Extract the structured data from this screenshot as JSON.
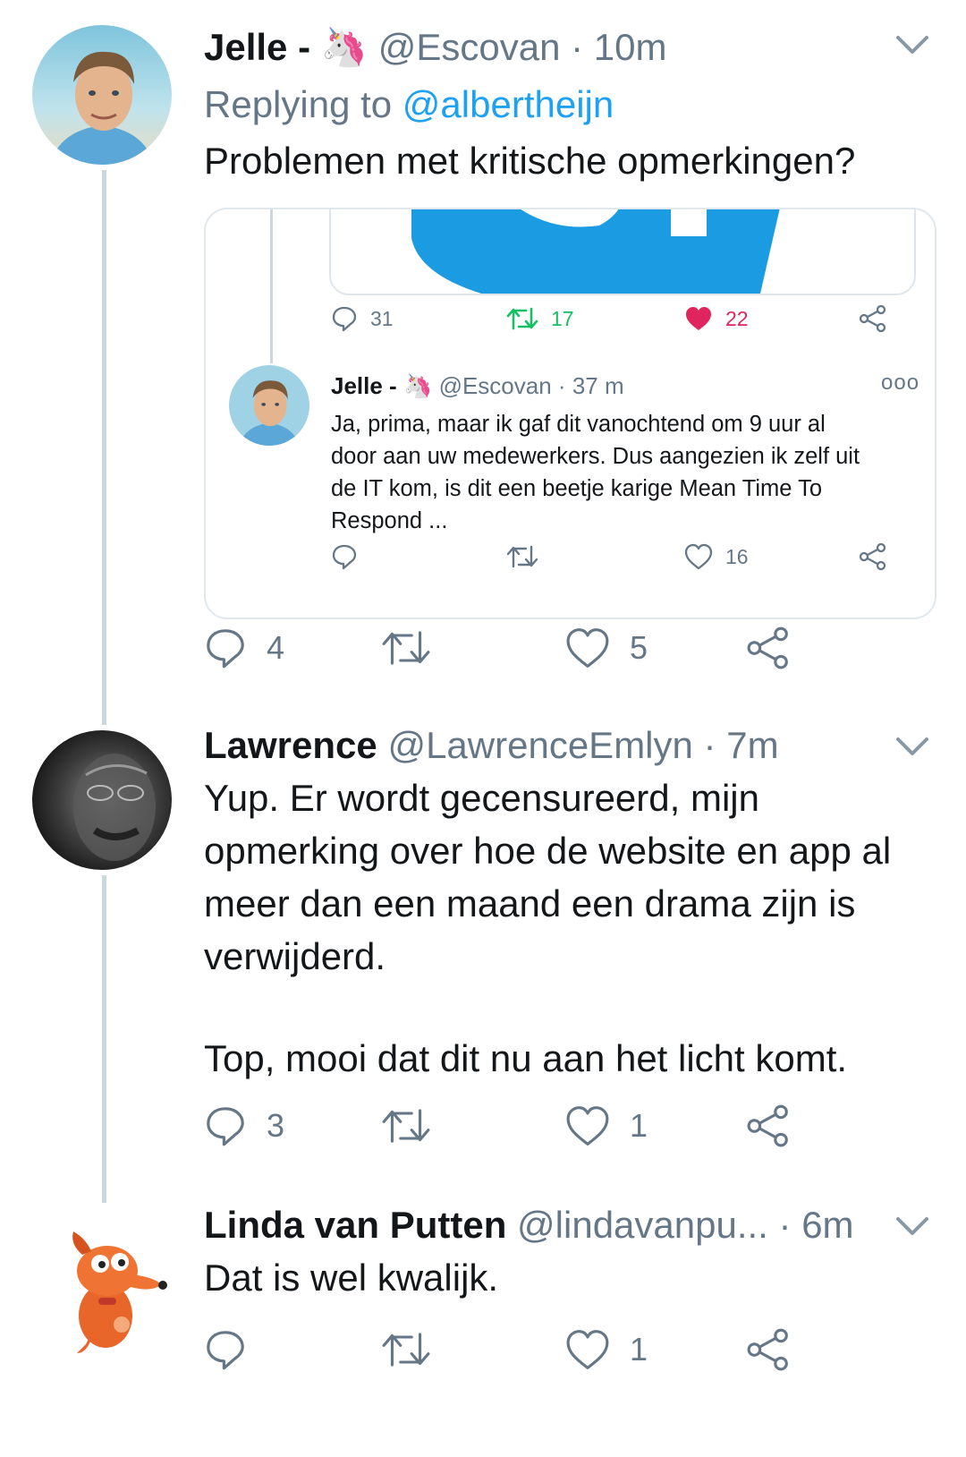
{
  "tweets": [
    {
      "name": "Jelle -",
      "emoji": "🦄",
      "handle": "@Escovan",
      "dot": "·",
      "time": "10m",
      "replying_prefix": "Replying to ",
      "replying_to": "@albertheijn",
      "text": "Problemen met kritische opmerkingen?",
      "replies": "4",
      "likes": "5"
    },
    {
      "name": "Lawrence",
      "handle": "@LawrenceEmlyn",
      "dot": "·",
      "time": "7m",
      "text_line1": "Yup. Er wordt gecensureerd, mijn",
      "text_line2": "opmerking over hoe de website en app al",
      "text_line3": "meer dan een maand een drama zijn is",
      "text_line4": "verwijderd.",
      "text_line5": "Top, mooi dat dit nu aan het licht komt.",
      "replies": "3",
      "likes": "1"
    },
    {
      "name": "Linda van Putten",
      "handle": "@lindavanpu...",
      "dot": "·",
      "time": "6m",
      "text": "Dat is wel kwalijk.",
      "likes": "1"
    }
  ],
  "quoted": {
    "top_stats": {
      "replies": "31",
      "retweets": "17",
      "likes": "22"
    },
    "name": "Jelle -",
    "emoji": "🦄",
    "handle": "@Escovan",
    "dot": "·",
    "time": "37 m",
    "more": "ooo",
    "text_line1": "Ja, prima, maar ik gaf dit vanochtend om 9 uur al",
    "text_line2": "door aan uw medewerkers. Dus aangezien ik zelf uit",
    "text_line3": "de IT kom, is dit een beetje karige Mean Time To",
    "text_line4": "Respond ...",
    "likes": "16"
  },
  "colors": {
    "link": "#1da1f2",
    "muted": "#657786",
    "retweet_green": "#17bf63",
    "like_red": "#e0245e",
    "thread_line": "#ccd6dd"
  },
  "icons": [
    "reply-icon",
    "retweet-icon",
    "like-icon",
    "share-icon",
    "chevron-down-icon",
    "more-icon"
  ]
}
